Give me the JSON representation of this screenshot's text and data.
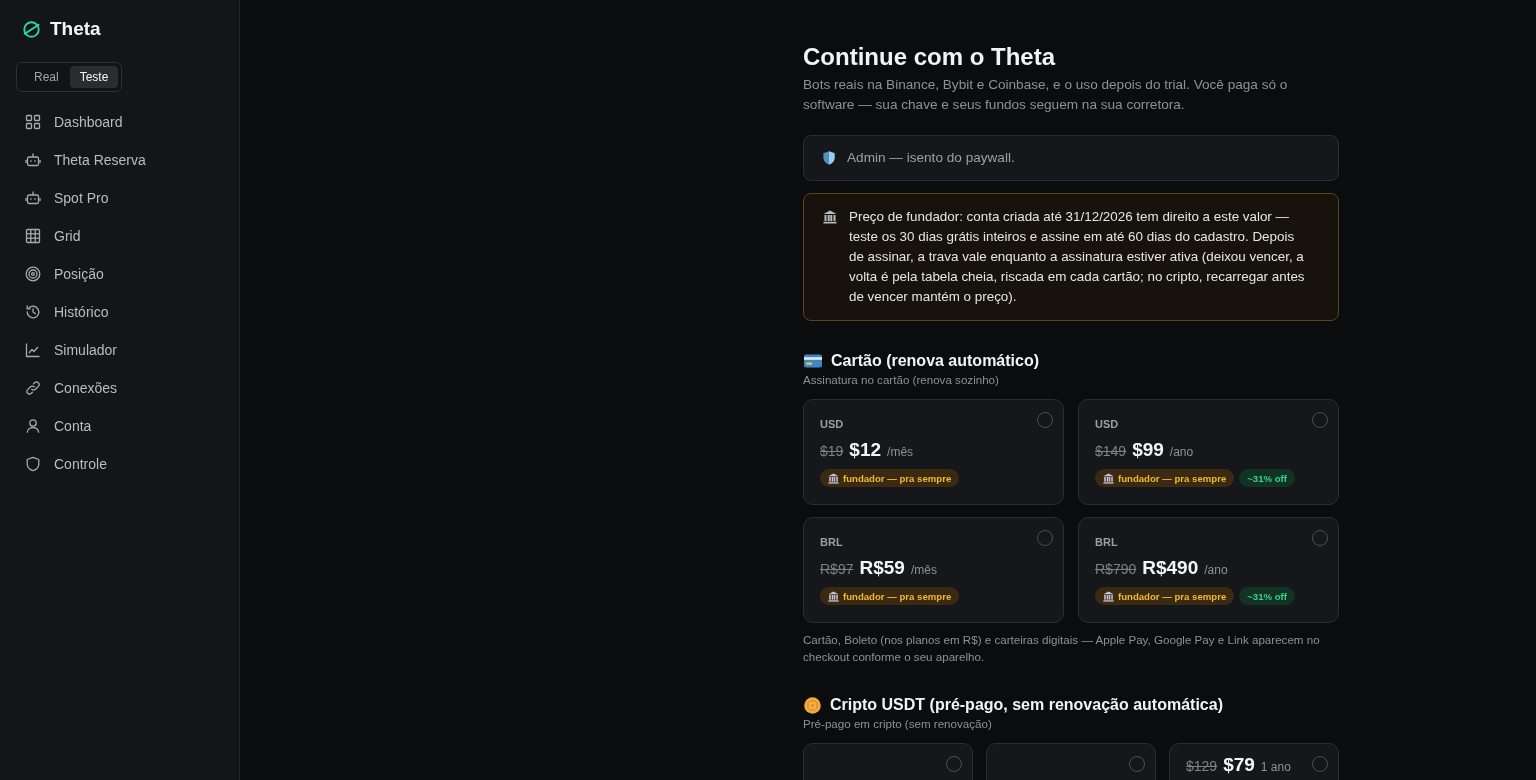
{
  "sidebar": {
    "brand": "Theta",
    "mode_toggle": [
      {
        "label": "Real",
        "selected": false
      },
      {
        "label": "Teste",
        "selected": true
      }
    ],
    "items": [
      {
        "label": "Dashboard",
        "selected": false
      },
      {
        "label": "Theta Reserva",
        "selected": false
      },
      {
        "label": "Spot Pro",
        "selected": false
      },
      {
        "label": "Grid",
        "selected": false
      },
      {
        "label": "Posição",
        "selected": false
      },
      {
        "label": "Histórico",
        "selected": false
      },
      {
        "label": "Simulador",
        "selected": false
      },
      {
        "label": "Conexões",
        "selected": false
      },
      {
        "label": "Conta",
        "selected": false
      },
      {
        "label": "Controle",
        "selected": false
      }
    ]
  },
  "main": {
    "title": "Continue com o Theta",
    "subtitle": "Bots reais na Binance, Bybit e Coinbase, e o uso depois do trial. Você paga só o software — sua chave e seus fundos seguem na sua corretora.",
    "admin_notice": "Admin — isento do paywall.",
    "founder_notice": "Preço de fundador: conta criada até 31/12/2026 tem direito a este valor — teste os 30 dias grátis inteiros e assine em até 60 dias do cadastro. Depois de assinar, a trava vale enquanto a assinatura estiver ativa (deixou vencer, a volta é pela tabela cheia, riscada em cada cartão; no cripto, recarregar antes de vencer mantém o preço).",
    "sections": [
      {
        "title": "Cartão (renova automático)",
        "subtitle": "Assinatura no cartão (renova sozinho)",
        "plans": [
          {
            "currency": "USD",
            "old_price": "$19",
            "price": "$12",
            "period": "/mês",
            "badges": [
              {
                "kind": "founder",
                "label": "fundador — pra sempre"
              }
            ],
            "selected": false
          },
          {
            "currency": "USD",
            "old_price": "$149",
            "price": "$99",
            "period": "/ano",
            "badges": [
              {
                "kind": "founder",
                "label": "fundador — pra sempre"
              },
              {
                "kind": "discount",
                "label": "~31% off"
              }
            ],
            "selected": false
          },
          {
            "currency": "BRL",
            "old_price": "R$97",
            "price": "R$59",
            "period": "/mês",
            "badges": [
              {
                "kind": "founder",
                "label": "fundador — pra sempre"
              }
            ],
            "selected": false
          },
          {
            "currency": "BRL",
            "old_price": "R$790",
            "price": "R$490",
            "period": "/ano",
            "badges": [
              {
                "kind": "founder",
                "label": "fundador — pra sempre"
              },
              {
                "kind": "discount",
                "label": "~31% off"
              }
            ],
            "selected": false
          }
        ],
        "footnote": "Cartão, Boleto (nos planos em R$) e carteiras digitais — Apple Pay, Google Pay e Link aparecem no checkout conforme o seu aparelho."
      },
      {
        "title": "Cripto USDT (pré-pago, sem renovação automática)",
        "subtitle": "Pré-pago em cripto (sem renovação)",
        "plans": [
          {
            "selected": false
          },
          {
            "selected": false
          },
          {
            "old_price": "$129",
            "price": "$79",
            "period": "1 ano",
            "selected": false
          }
        ]
      }
    ]
  }
}
